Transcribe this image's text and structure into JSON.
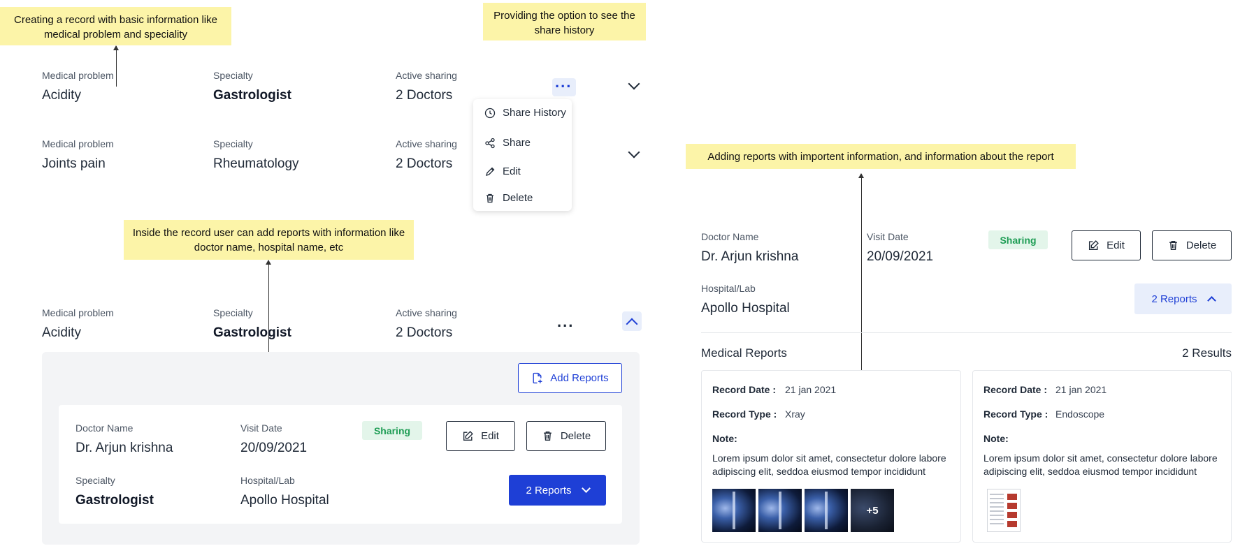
{
  "annotations": {
    "create_record": "Creating a record with basic information like medical problem and speciality",
    "share_history": "Providing the option to see the share history",
    "inside_record": "Inside the record user can add reports  with information like doctor name, hospital name, etc",
    "adding_reports": "Adding reports with importent information, and information about the report"
  },
  "labels": {
    "medical_problem": "Medical problem",
    "specialty": "Specialty",
    "active_sharing": "Active sharing",
    "doctor_name": "Doctor Name",
    "visit_date": "Visit Date",
    "hospital_lab": "Hospital/Lab"
  },
  "records": [
    {
      "medical_problem": "Acidity",
      "specialty": "Gastrologist",
      "active_sharing": "2 Doctors"
    },
    {
      "medical_problem": "Joints pain",
      "specialty": "Rheumatology",
      "active_sharing": "2 Doctors"
    },
    {
      "medical_problem": "Acidity",
      "specialty": "Gastrologist",
      "active_sharing": "2 Doctors"
    }
  ],
  "dots": "...",
  "menu": {
    "items": [
      {
        "label": "Share History",
        "icon": "clock-icon"
      },
      {
        "label": "Share",
        "icon": "share-icon"
      },
      {
        "label": "Edit",
        "icon": "pencil-icon"
      },
      {
        "label": "Delete",
        "icon": "trash-icon"
      }
    ]
  },
  "expanded": {
    "add_reports": "Add Reports",
    "report": {
      "doctor_name": "Dr. Arjun krishna",
      "visit_date": "20/09/2021",
      "status": "Sharing",
      "specialty": "Gastrologist",
      "hospital": "Apollo Hospital",
      "edit": "Edit",
      "delete": "Delete",
      "reports_button": "2 Reports"
    }
  },
  "detail": {
    "doctor_name": "Dr. Arjun krishna",
    "visit_date": "20/09/2021",
    "status": "Sharing",
    "hospital": "Apollo Hospital",
    "edit": "Edit",
    "delete": "Delete",
    "reports_button": "2 Reports",
    "medical_reports_title": "Medical Reports",
    "results_count": "2 Results",
    "record_date_label": "Record Date :",
    "record_type_label": "Record Type :",
    "note_label": "Note:",
    "cards": [
      {
        "record_date": "21 jan 2021",
        "record_type": "Xray",
        "note": "Lorem ipsum dolor sit amet, consectetur dolore labore adipiscing elit, seddoa eiusmod tempor incididunt",
        "more_count": "+5"
      },
      {
        "record_date": "21 jan 2021",
        "record_type": "Endoscope",
        "note": "Lorem ipsum dolor sit amet, consectetur dolore labore adipiscing elit, seddoa eiusmod tempor incididunt"
      }
    ]
  },
  "colors": {
    "annotation_bg": "#fcf4a8",
    "accent_blue": "#1e3fd6",
    "sharing_green": "#1f9d55",
    "panel_bg": "#f3f4f6"
  }
}
